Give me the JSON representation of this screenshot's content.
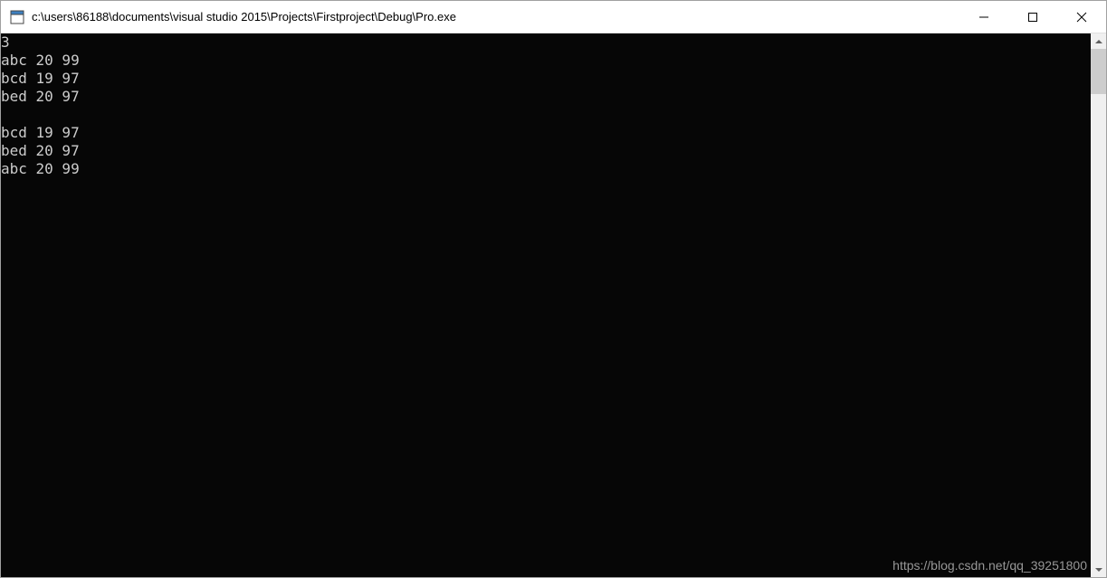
{
  "window": {
    "title": "c:\\users\\86188\\documents\\visual studio 2015\\Projects\\Firstproject\\Debug\\Pro.exe"
  },
  "console": {
    "lines": [
      "3",
      "abc 20 99",
      "bcd 19 97",
      "bed 20 97",
      "",
      "bcd 19 97",
      "bed 20 97",
      "abc 20 99"
    ]
  },
  "watermark": "https://blog.csdn.net/qq_39251800"
}
